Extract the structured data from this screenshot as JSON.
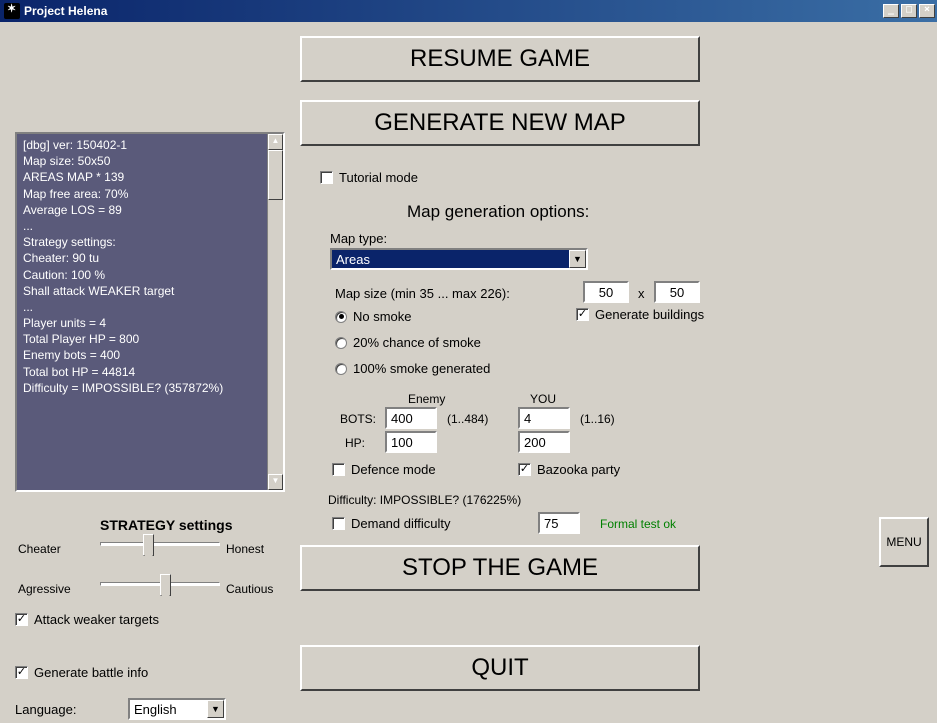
{
  "window": {
    "title": "Project Helena"
  },
  "buttons": {
    "resume": "RESUME GAME",
    "generate": "GENERATE NEW MAP",
    "stop": "STOP THE GAME",
    "quit": "QUIT",
    "menu": "MENU"
  },
  "tutorial": {
    "label": "Tutorial mode",
    "checked": false
  },
  "mapgen": {
    "heading": "Map generation options:",
    "type_label": "Map type:",
    "type_value": "Areas",
    "size_label": "Map size (min 35 ... max 226):",
    "size_w": "50",
    "size_x": "x",
    "size_h": "50",
    "gen_buildings": {
      "label": "Generate buildings",
      "checked": true
    },
    "smoke": {
      "no": "No smoke",
      "p20": "20% chance of smoke",
      "p100": "100% smoke generated",
      "selected": "no"
    },
    "cols": {
      "enemy": "Enemy",
      "you": "YOU"
    },
    "bots_label": "BOTS:",
    "hp_label": "HP:",
    "enemy_bots": "400",
    "enemy_bots_range": "(1..484)",
    "you_bots": "4",
    "you_bots_range": "(1..16)",
    "enemy_hp": "100",
    "you_hp": "200",
    "defence": {
      "label": "Defence mode",
      "checked": false
    },
    "bazooka": {
      "label": "Bazooka party",
      "checked": true
    },
    "difficulty_line": "Difficulty: IMPOSSIBLE? (176225%)",
    "demand": {
      "label": "Demand difficulty",
      "checked": false,
      "value": "75"
    },
    "formal": "Formal test ok"
  },
  "strategy": {
    "heading": "STRATEGY settings",
    "left1": "Cheater",
    "right1": "Honest",
    "left2": "Agressive",
    "right2": "Cautious",
    "attack_weaker": {
      "label": "Attack weaker targets",
      "checked": true
    }
  },
  "bottom": {
    "gen_battle": {
      "label": "Generate battle info",
      "checked": true
    },
    "lang_label": "Language:",
    "lang_value": "English"
  },
  "log": "[dbg] ver: 150402-1\nMap size: 50x50\nAREAS MAP * 139\nMap free area: 70%\nAverage LOS = 89\n...\nStrategy settings:\nCheater: 90 tu\nCaution: 100 %\nShall attack WEAKER target\n...\nPlayer units = 4\nTotal Player HP = 800\nEnemy bots = 400\nTotal bot HP = 44814\nDifficulty = IMPOSSIBLE? (357872%)"
}
